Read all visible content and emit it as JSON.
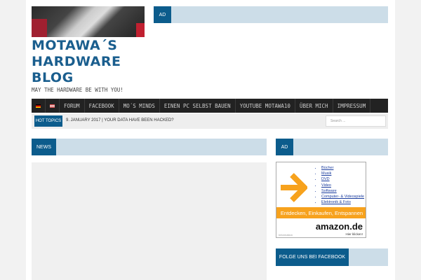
{
  "header": {
    "title_lines": [
      "MOTAWA´S",
      "HARDWARE",
      "BLOG"
    ],
    "tagline": "MAY THE HARDWARE BE WITH YOU!",
    "ad_label": "AD"
  },
  "nav": {
    "items": [
      "FORUM",
      "FACEBOOK",
      "MO´S MINDS",
      "EINEN PC SELBST BAUEN",
      "YOUTUBE MOTAWA10",
      "ÜBER MICH",
      "IMPRESSUM"
    ]
  },
  "hot": {
    "label": "HOT TOPICS",
    "text": "9. JANUARY 2017  |  YOUR DATA HAVE BEEN HACKED?",
    "search_placeholder": "Search ..."
  },
  "main": {
    "news_label": "NEWS"
  },
  "sidebar": {
    "ad_label": "AD",
    "facebook_label": "FOLGE UNS BEI FACEBOOK",
    "amazon": {
      "links": [
        "Bücher",
        "Musik",
        "DVD",
        "Video",
        "Software",
        "Computer- & Videospiele",
        "Elektronik & Foto"
      ],
      "slogan": "Entdecken, Einkaufen, Entspannen",
      "logo": "amazon.de",
      "cta": "Hier klicken!",
      "info": "Information"
    }
  },
  "colors": {
    "accent": "#0c5c8c",
    "bar": "#ccdde8",
    "title": "#1a5e8e"
  }
}
